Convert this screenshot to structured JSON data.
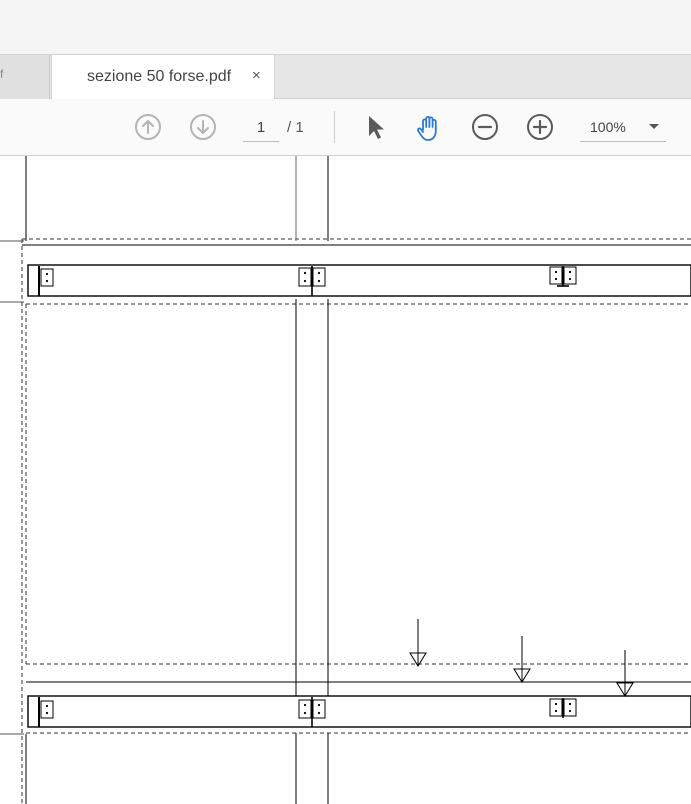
{
  "tabs": {
    "previous_tab_edge": "f",
    "active_tab": {
      "title": "sezione 50 forse.pdf",
      "close_glyph": "×"
    }
  },
  "toolbar": {
    "prev_page_icon": "arrow-up-circle-icon",
    "next_page_icon": "arrow-down-circle-icon",
    "current_page": "1",
    "page_total": "/ 1",
    "select_tool_icon": "pointer-arrow-icon",
    "hand_tool_icon": "hand-icon",
    "zoom_out_icon": "minus-circle-icon",
    "zoom_in_icon": "plus-circle-icon",
    "zoom_level": "100%",
    "active_tool_color": "#2b7bd6",
    "icon_color": "#5a5a5a",
    "disabled_icon_color": "#b4b4b4"
  },
  "document": {
    "content": "technical drawing of a steel frame section (columns, beams, bolted connections, load arrows)"
  }
}
